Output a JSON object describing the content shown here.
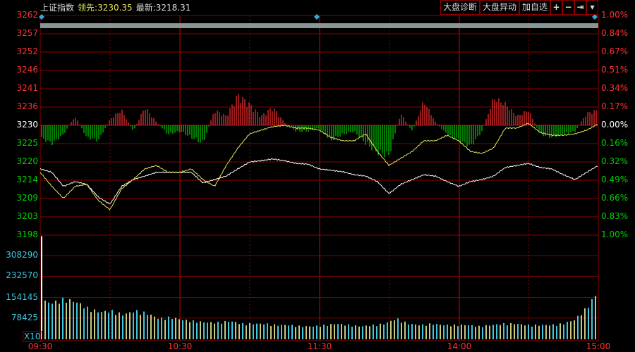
{
  "header": {
    "index_name": "上证指数",
    "leading_label": "领先:",
    "leading_value": "3230.35",
    "latest_label": "最新:",
    "latest_value": "3218.31"
  },
  "toolbar": {
    "diagnose": "大盘诊断",
    "movement": "大盘异动",
    "add_watch": "加自选",
    "zoom_in": "+",
    "zoom_out": "−",
    "jump_end": "⇥",
    "menu": "▾"
  },
  "colors": {
    "up": "#ff3030",
    "down": "#00d000",
    "grid": "#8b0000",
    "price": "#ffffff",
    "leading": "#e6e65a",
    "volume_cyan": "#40c8e0",
    "volume_yellow": "#c8c87a"
  },
  "chart_data": {
    "type": "line",
    "prev_close": 3230,
    "price_axis": {
      "labels": [
        "3262",
        "3257",
        "3252",
        "3246",
        "3241",
        "3236",
        "3230",
        "3225",
        "3220",
        "3214",
        "3209",
        "3203",
        "3198"
      ],
      "range": [
        3198,
        3262
      ]
    },
    "percent_axis": [
      "1.00%",
      "0.84%",
      "0.67%",
      "0.51%",
      "0.34%",
      "0.17%",
      "0.00%",
      "0.16%",
      "0.32%",
      "0.49%",
      "0.66%",
      "0.83%",
      "1.00%"
    ],
    "volume_axis": {
      "labels": [
        "308290",
        "232570",
        "154145",
        "78425"
      ],
      "multiplier": "X10",
      "max": 384000
    },
    "time_labels": [
      "09:30",
      "10:30",
      "11:30",
      "14:00",
      "15:00"
    ],
    "series": [
      {
        "name": "最新",
        "values": [
          3217.3,
          3216.3,
          3212.2,
          3213.6,
          3212.8,
          3209.1,
          3207.0,
          3212.2,
          3214.2,
          3215.2,
          3216.3,
          3216.3,
          3216.3,
          3216.3,
          3213.2,
          3214.2,
          3215.2,
          3217.3,
          3219.3,
          3219.7,
          3220.2,
          3219.7,
          3218.9,
          3218.7,
          3217.3,
          3216.9,
          3216.5,
          3215.6,
          3215.2,
          3213.6,
          3210.1,
          3212.8,
          3214.2,
          3215.6,
          3215.2,
          3213.6,
          3212.2,
          3213.6,
          3214.2,
          3215.2,
          3217.7,
          3218.3,
          3218.9,
          3217.7,
          3217.3,
          3215.6,
          3214.2,
          3216.3,
          3218.3
        ]
      },
      {
        "name": "领先",
        "values": [
          3216.3,
          3212.2,
          3208.7,
          3212.2,
          3212.8,
          3208.1,
          3205.4,
          3211.5,
          3214.2,
          3217.3,
          3218.3,
          3216.3,
          3216.3,
          3217.3,
          3214.2,
          3212.2,
          3218.3,
          3223.4,
          3227.5,
          3228.6,
          3229.6,
          3230.0,
          3229.2,
          3229.2,
          3228.6,
          3226.5,
          3225.5,
          3225.5,
          3227.5,
          3222.4,
          3218.3,
          3220.4,
          3222.4,
          3225.5,
          3225.5,
          3227.1,
          3225.5,
          3222.4,
          3221.8,
          3223.4,
          3229.2,
          3229.2,
          3230.6,
          3227.9,
          3227.1,
          3227.1,
          3227.5,
          3228.6,
          3230.4
        ]
      }
    ],
    "strength": [
      -20,
      -30,
      -15,
      15,
      -20,
      -25,
      10,
      25,
      -10,
      30,
      5,
      -15,
      -10,
      -20,
      -30,
      25,
      15,
      50,
      35,
      15,
      30,
      5,
      -10,
      -10,
      -5,
      -25,
      -15,
      -10,
      -30,
      -45,
      -50,
      20,
      -10,
      40,
      5,
      -15,
      -25,
      -35,
      -10,
      45,
      35,
      15,
      25,
      -15,
      -20,
      -15,
      -10,
      20,
      25
    ],
    "volume": [
      380000,
      150000,
      140000,
      155000,
      145000,
      120000,
      105000,
      110000,
      95000,
      110000,
      100000,
      80000,
      85000,
      75000,
      70000,
      65000,
      65000,
      70000,
      60000,
      60000,
      60000,
      55000,
      55000,
      50000,
      50000,
      55000,
      60000,
      55000,
      50000,
      55000,
      60000,
      80000,
      60000,
      55000,
      60000,
      55000,
      55000,
      55000,
      50000,
      55000,
      60000,
      60000,
      55000,
      55000,
      55000,
      60000,
      75000,
      120000,
      185000
    ]
  }
}
